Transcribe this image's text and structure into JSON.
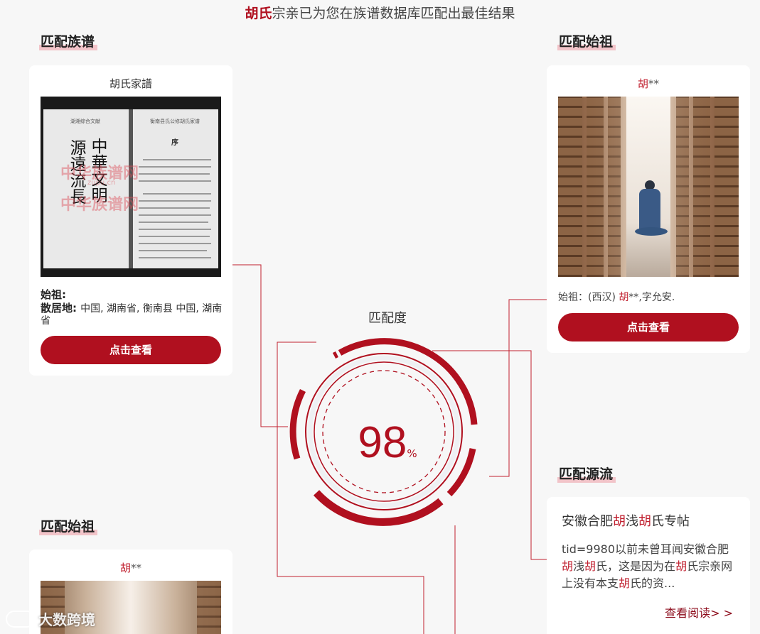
{
  "headline": {
    "surname": "胡氏",
    "rest": "宗亲已为您在族谱数据库匹配出最佳结果"
  },
  "sections": {
    "genealogy": "匹配族谱",
    "ancestor_top": "匹配始祖",
    "source": "匹配源流",
    "ancestor_bottom": "匹配始祖"
  },
  "genealogy_card": {
    "title": "胡氏家譜",
    "calligraphy_left": "源遠流長",
    "calligraphy_right": "中華文明",
    "watermark": "中华族谱网",
    "watermark_url": "zupu.cn",
    "page_title_left": "湖湘综合文献",
    "page_title_right": "衡南县氏公修胡氏家谱",
    "preface": "序",
    "ancestor_label": "始祖:",
    "residence_label": "散居地:",
    "residence_value": "中国, 湖南省, 衡南县 中国, 湖南省",
    "button": "点击查看"
  },
  "ancestor_card_top": {
    "name_red": "胡",
    "name_rest": "**",
    "info_prefix": "始祖：(西汉) ",
    "info_red": "胡",
    "info_rest": "**,字允安.",
    "button": "点击查看"
  },
  "match": {
    "label": "匹配度",
    "value": "98",
    "unit": "%"
  },
  "source_card": {
    "title_parts": [
      "安徽合肥",
      "胡",
      "浅",
      "胡",
      "氏专帖"
    ],
    "body_parts": [
      "tid=9980以前未曾耳闻安徽合肥",
      "胡",
      "浅",
      "胡",
      "氏，这是因为在",
      "胡",
      "氏宗亲网上没有本支",
      "胡",
      "氏的资..."
    ],
    "link": "查看阅读> >"
  },
  "ancestor_card_bottom": {
    "name_red": "胡",
    "name_rest": "**"
  },
  "brand_watermark": "大数跨境",
  "colors": {
    "accent": "#b0101f",
    "highlight": "#f2c4c9",
    "background": "#f7f7f7"
  }
}
